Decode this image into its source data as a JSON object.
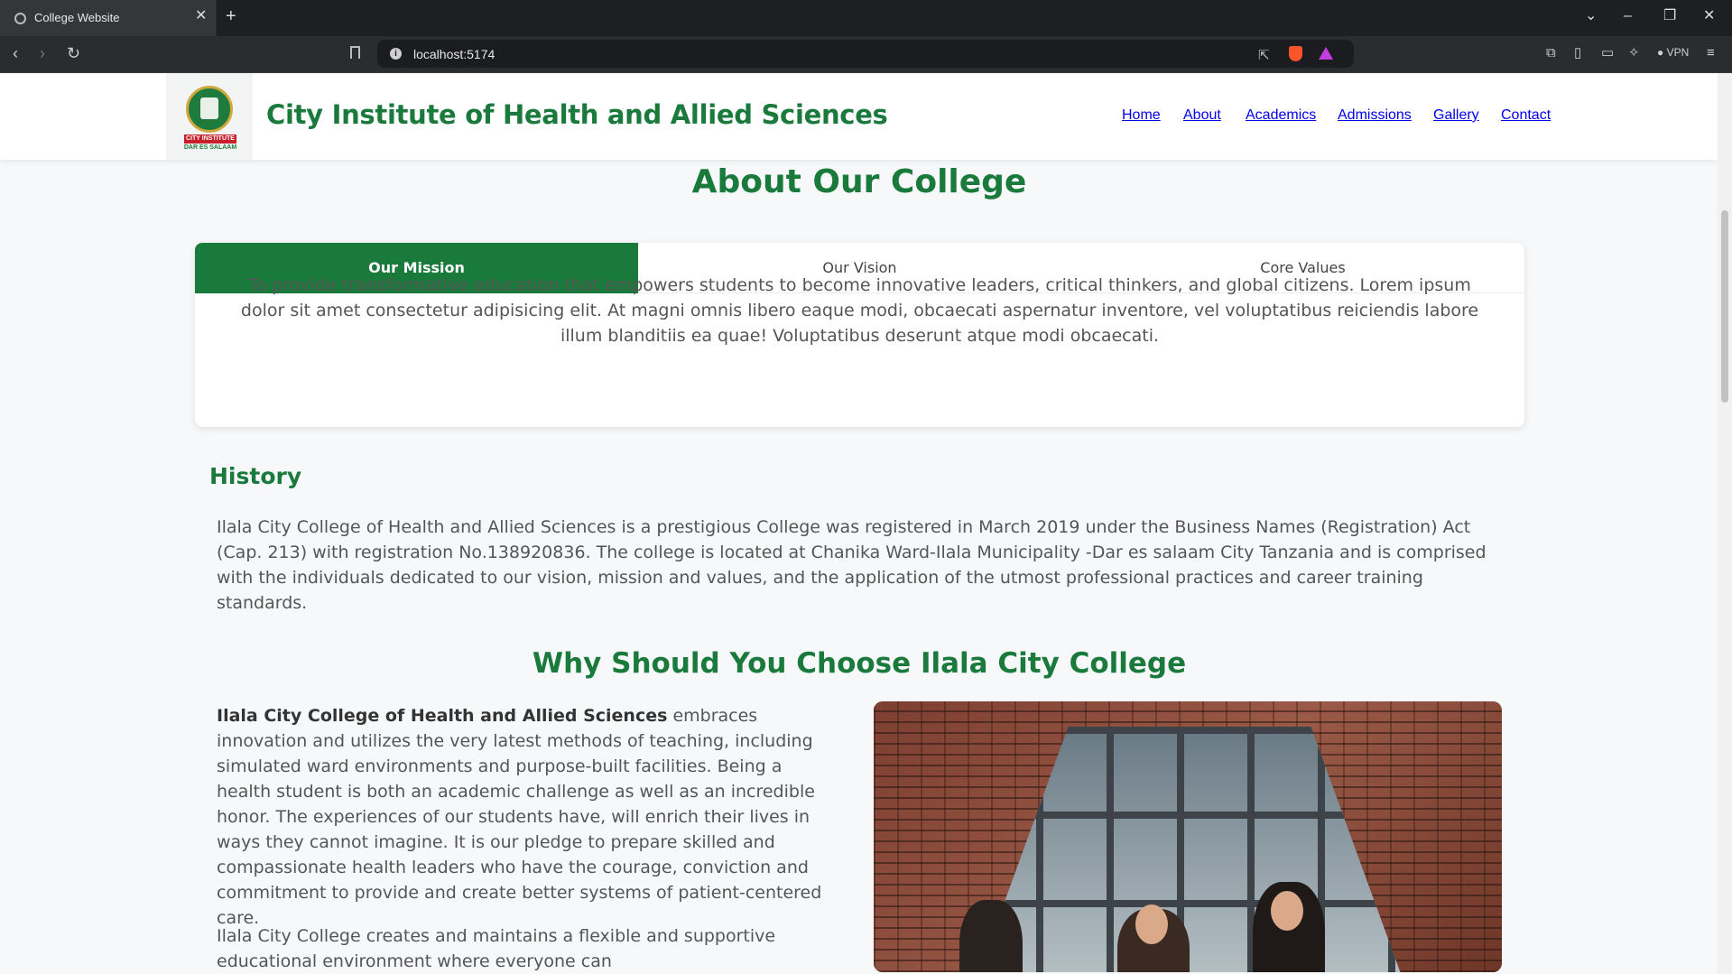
{
  "browser": {
    "tab_title": "College Website",
    "url": "localhost:5174",
    "vpn_label": "VPN"
  },
  "header": {
    "logo_band_text": "CITY INSTITUTE",
    "logo_sub_text": "DAR ES SALAAM",
    "title": "City Institute of Health and Allied Sciences",
    "nav": [
      "Home",
      "About",
      "Academics",
      "Admissions",
      "Gallery",
      "Contact"
    ]
  },
  "about": {
    "title": "About Our College",
    "tabs": [
      "Our Mission",
      "Our Vision",
      "Core Values"
    ],
    "active_tab": "Our Mission",
    "mission_text": "To provide transformative education that empowers students to become innovative leaders, critical thinkers, and global citizens. Lorem ipsum dolor sit amet consectetur adipisicing elit. At magni omnis libero eaque modi, obcaecati aspernatur inventore, vel voluptatibus reiciendis labore illum blanditiis ea quae! Voluptatibus deserunt atque modi obcaecati."
  },
  "history": {
    "title": "History",
    "text": "Ilala City College of Health and Allied Sciences is a prestigious College was registered in March 2019 under the Business Names (Registration) Act (Cap. 213) with registration No.138920836. The college is located at Chanika Ward-Ilala Municipality -Dar es salaam City Tanzania and is comprised with the individuals dedicated to our vision, mission and values, and the application of the utmost professional practices and career training standards."
  },
  "why": {
    "title": "Why Should You Choose Ilala City College",
    "bold_lead": "Ilala City College of Health and Allied Sciences",
    "text": " embraces innovation and utilizes the very latest methods of teaching, including simulated ward environments and purpose-built facilities. Being a health student is both an academic challenge as well as an incredible honor. The experiences of our students have, will enrich their lives in ways they cannot imagine. It is our pledge to prepare skilled and compassionate health leaders who have the courage, conviction and commitment to provide and create better systems of patient-centered care.",
    "text2": "Ilala City College creates and maintains a flexible and supportive educational environment where everyone can"
  },
  "colors": {
    "brand_green": "#1a7a3c",
    "tab_active_bg": "#1a7a3c"
  }
}
